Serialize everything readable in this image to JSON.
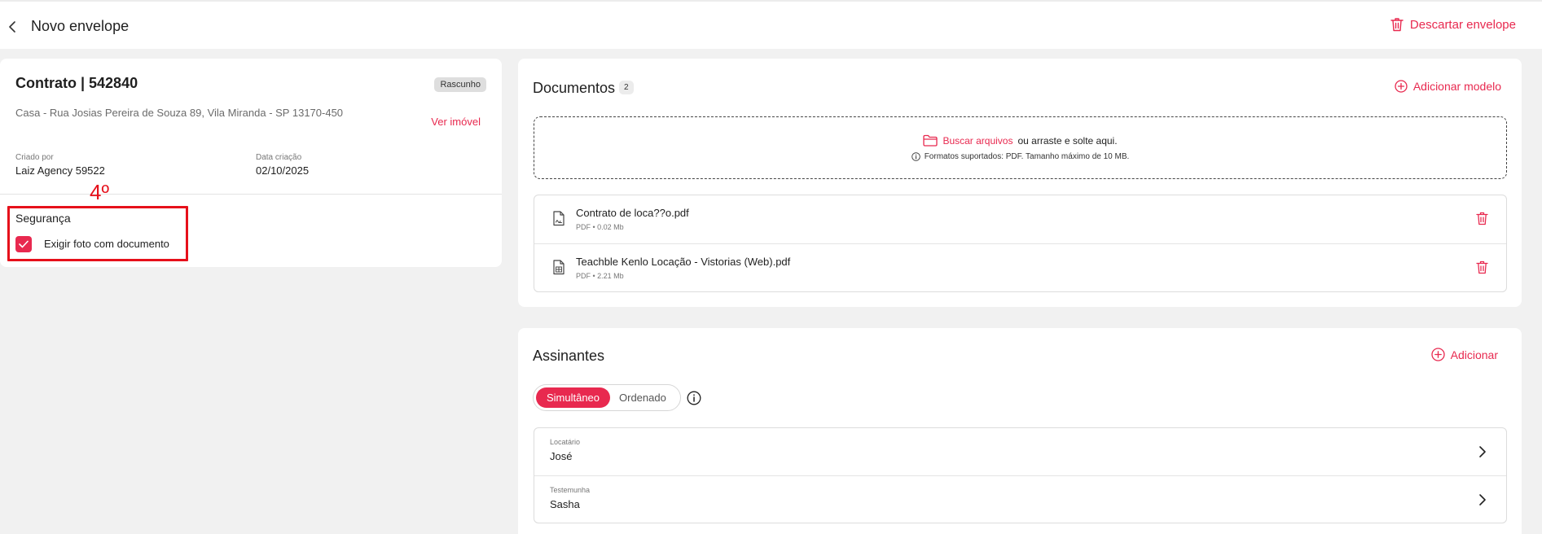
{
  "header": {
    "title": "Novo envelope",
    "discard_label": "Descartar envelope"
  },
  "contract": {
    "title": "Contrato | 542840",
    "status_badge": "Rascunho",
    "address": "Casa - Rua Josias Pereira de Souza 89, Vila Miranda - SP 13170-450",
    "view_property_label": "Ver imóvel",
    "created_by_label": "Criado por",
    "created_by_value": "Laiz Agency 59522",
    "creation_date_label": "Data criação",
    "creation_date_value": "02/10/2025"
  },
  "security": {
    "title": "Segurança",
    "require_photo_label": "Exigir foto com documento",
    "require_photo_checked": true
  },
  "annotation": {
    "label": "4º",
    "color": "#e6101b"
  },
  "documents": {
    "title": "Documentos",
    "count": "2",
    "add_template_label": "Adicionar modelo",
    "dropzone": {
      "browse_label": "Buscar arquivos",
      "drag_text": "ou arraste e solte aqui.",
      "formats_text": "Formatos suportados: PDF. Tamanho máximo de 10 MB."
    },
    "files": [
      {
        "name": "Contrato de loca??o.pdf",
        "meta": "PDF • 0.02 Mb",
        "icon": "file-contract-icon"
      },
      {
        "name": "Teachble Kenlo Locação - Vistorias (Web).pdf",
        "meta": "PDF • 2.21 Mb",
        "icon": "file-table-icon"
      }
    ]
  },
  "signers": {
    "title": "Assinantes",
    "add_label": "Adicionar",
    "modes": {
      "active": "Simultâneo",
      "inactive": "Ordenado"
    },
    "list": [
      {
        "role": "Locatário",
        "name": "José"
      },
      {
        "role": "Testemunha",
        "name": "Sasha"
      }
    ]
  },
  "colors": {
    "accent": "#e8294f",
    "background": "#f1f1f1",
    "card": "#ffffff"
  }
}
